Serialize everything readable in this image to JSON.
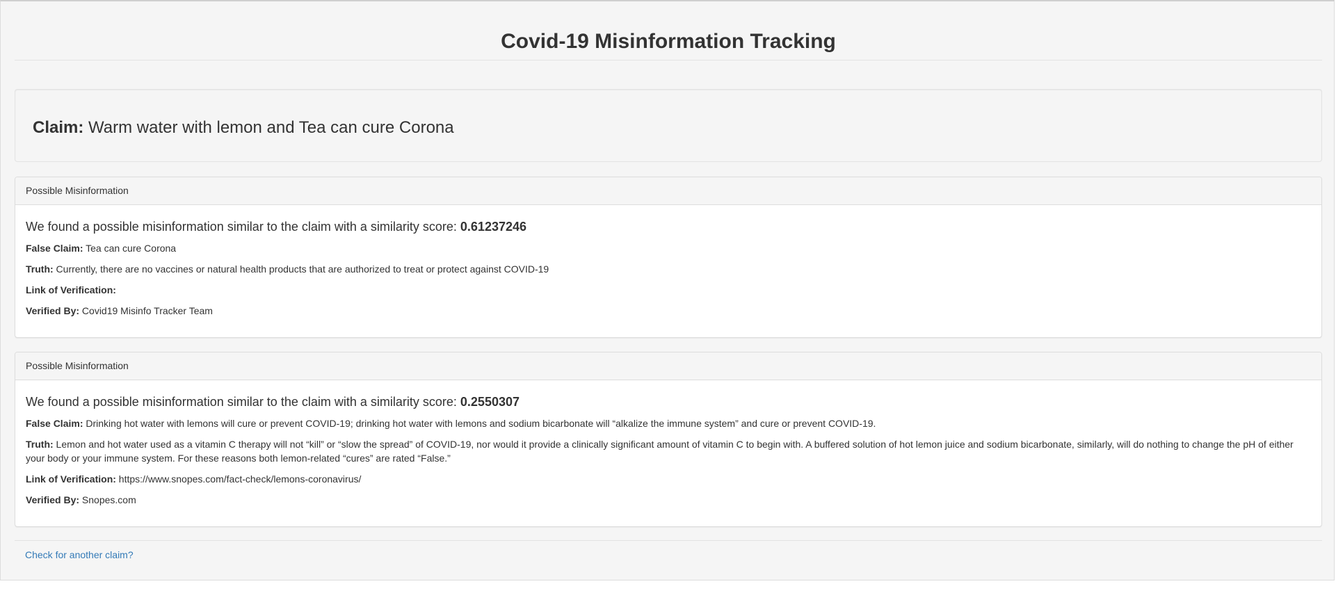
{
  "page_title": "Covid-19 Misinformation Tracking",
  "claim": {
    "label": "Claim:",
    "text": "Warm water with lemon and Tea can cure Corona"
  },
  "results": [
    {
      "heading": "Possible Misinformation",
      "score_prefix": "We found a possible misinformation similar to the claim with a similarity score:",
      "score": "0.61237246",
      "false_claim_label": "False Claim:",
      "false_claim": "Tea can cure Corona",
      "truth_label": "Truth:",
      "truth": "Currently, there are no vaccines or natural health products that are authorized to treat or protect against COVID-19",
      "link_label": "Link of Verification:",
      "link": "",
      "verified_label": "Verified By:",
      "verified_by": "Covid19 Misinfo Tracker Team"
    },
    {
      "heading": "Possible Misinformation",
      "score_prefix": "We found a possible misinformation similar to the claim with a similarity score:",
      "score": "0.2550307",
      "false_claim_label": "False Claim:",
      "false_claim": "Drinking hot water with lemons will cure or prevent COVID-19; drinking hot water with lemons and sodium bicarbonate will “alkalize the immune system” and cure or prevent COVID-19.",
      "truth_label": "Truth:",
      "truth": "Lemon and hot water used as a vitamin C therapy will not “kill” or “slow the spread” of COVID-19, nor would it provide a clinically significant amount of vitamin C to begin with. A buffered solution of hot lemon juice and sodium bicarbonate, similarly, will do nothing to change the pH of either your body or your immune system. For these reasons both lemon-related “cures” are rated “False.”",
      "link_label": "Link of Verification:",
      "link": "https://www.snopes.com/fact-check/lemons-coronavirus/",
      "verified_label": "Verified By:",
      "verified_by": "Snopes.com"
    }
  ],
  "footer_link": "Check for another claim?",
  "colors": {
    "link": "#337ab7",
    "background": "#f5f5f5",
    "panel_border": "#dddddd"
  }
}
